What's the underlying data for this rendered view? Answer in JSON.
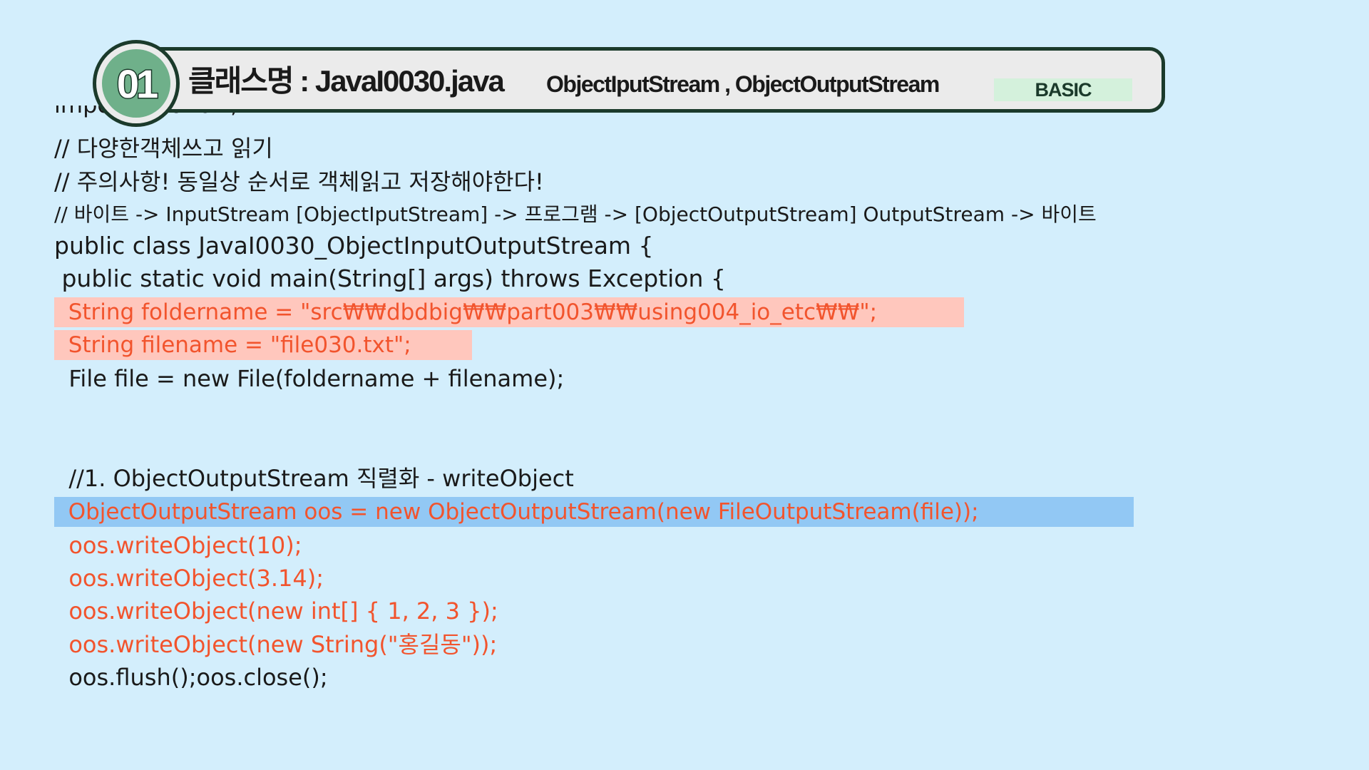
{
  "header": {
    "number": "01",
    "title": "클래스명 : JavaI0030.java",
    "subtitle": "ObjectIputStream , ObjectOutputStream",
    "level": "BASIC"
  },
  "code": {
    "clipped_line": "import java.io.*;",
    "lines": [
      "// 다양한객체쓰고 읽기",
      "// 주의사항! 동일상 순서로 객체읽고 저장해야한다!",
      "// 바이트 -> InputStream [ObjectIputStream] -> 프로그램 -> [ObjectOutputStream] OutputStream -> 바이트",
      "public class JavaI0030_ObjectInputOutputStream {",
      " public static void main(String[] args) throws Exception {",
      "  String foldername = \"src₩₩dbdbig₩₩part003₩₩using004_io_etc₩₩\";",
      "  String filename = \"file030.txt\";",
      "  File file = new File(foldername + filename);",
      "  //1. ObjectOutputStream 직렬화 - writeObject",
      "  ObjectOutputStream oos = new ObjectOutputStream(new FileOutputStream(file));",
      "  oos.writeObject(10);",
      "  oos.writeObject(3.14);",
      "  oos.writeObject(new int[] { 1, 2, 3 });",
      "  oos.writeObject(new String(\"홍길동\"));",
      "  oos.flush();oos.close();"
    ]
  },
  "colors": {
    "background": "#d3eefc",
    "highlight_red": "#ffc7bd",
    "highlight_blue": "#92c8f4",
    "code_orange": "#f2542d",
    "badge_green": "#6fb08a",
    "level_tag_bg": "#d4f1dc"
  }
}
